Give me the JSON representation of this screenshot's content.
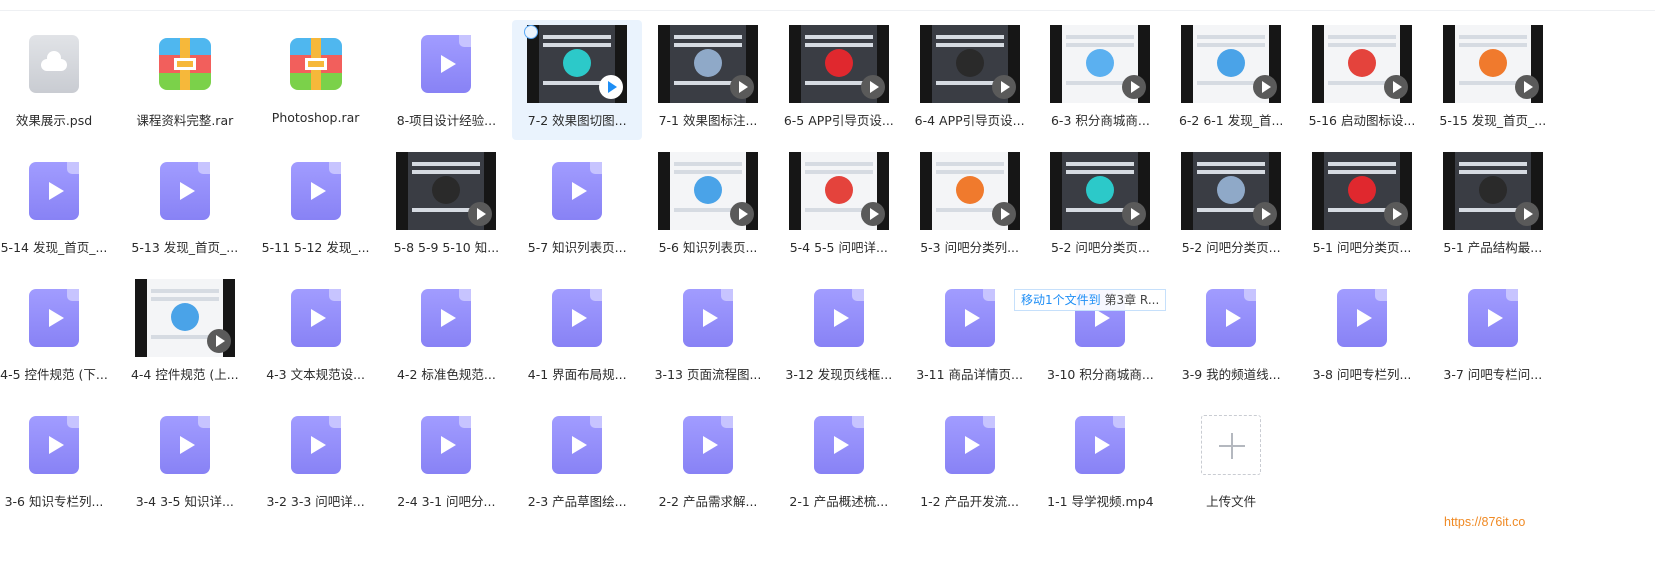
{
  "files": [
    {
      "name": "效果展示.psd",
      "icon": "psd-file-icon",
      "type": "psd"
    },
    {
      "name": "课程资料完整.rar",
      "icon": "rar-archive-icon",
      "type": "rar"
    },
    {
      "name": "Photoshop.rar",
      "icon": "rar-archive-icon",
      "type": "rar"
    },
    {
      "name": "8-项目设计经验...",
      "icon": "video-file-icon",
      "type": "video"
    },
    {
      "name": "7-2 效果图切图...",
      "icon": "video-thumbnail",
      "type": "thumb",
      "selected": true
    },
    {
      "name": "7-1 效果图标注...",
      "icon": "video-thumbnail",
      "type": "thumb"
    },
    {
      "name": "6-5 APP引导页设...",
      "icon": "video-thumbnail",
      "type": "thumb"
    },
    {
      "name": "6-4 APP引导页设...",
      "icon": "video-thumbnail",
      "type": "thumb"
    },
    {
      "name": "6-3 积分商城商...",
      "icon": "video-thumbnail",
      "type": "thumb"
    },
    {
      "name": "6-2 6-1 发现_首...",
      "icon": "video-thumbnail",
      "type": "thumb"
    },
    {
      "name": "5-16 启动图标设...",
      "icon": "video-thumbnail",
      "type": "thumb"
    },
    {
      "name": "5-15 发现_首页_...",
      "icon": "video-thumbnail",
      "type": "thumb"
    },
    {
      "name": "5-14 发现_首页_...",
      "icon": "video-file-icon",
      "type": "video"
    },
    {
      "name": "5-13 发现_首页_...",
      "icon": "video-file-icon",
      "type": "video"
    },
    {
      "name": "5-11 5-12 发现_...",
      "icon": "video-file-icon",
      "type": "video"
    },
    {
      "name": "5-8 5-9 5-10 知...",
      "icon": "video-thumbnail",
      "type": "thumb"
    },
    {
      "name": "5-7 知识列表页...",
      "icon": "video-file-icon",
      "type": "video"
    },
    {
      "name": "5-6 知识列表页...",
      "icon": "video-thumbnail",
      "type": "thumb"
    },
    {
      "name": "5-4 5-5 问吧详...",
      "icon": "video-thumbnail",
      "type": "thumb"
    },
    {
      "name": "5-3 问吧分类列...",
      "icon": "video-thumbnail",
      "type": "thumb"
    },
    {
      "name": "5-2 问吧分类页...",
      "icon": "video-thumbnail",
      "type": "thumb"
    },
    {
      "name": "5-2 问吧分类页...",
      "icon": "video-thumbnail",
      "type": "thumb"
    },
    {
      "name": "5-1 问吧分类页...",
      "icon": "video-thumbnail",
      "type": "thumb"
    },
    {
      "name": "5-1 产品结构最...",
      "icon": "video-thumbnail",
      "type": "thumb"
    },
    {
      "name": "4-5 控件规范 (下...",
      "icon": "video-file-icon",
      "type": "video"
    },
    {
      "name": "4-4 控件规范 (上...",
      "icon": "video-thumbnail",
      "type": "thumb"
    },
    {
      "name": "4-3 文本规范设...",
      "icon": "video-file-icon",
      "type": "video"
    },
    {
      "name": "4-2 标准色规范...",
      "icon": "video-file-icon",
      "type": "video"
    },
    {
      "name": "4-1 界面布局规...",
      "icon": "video-file-icon",
      "type": "video"
    },
    {
      "name": "3-13 页面流程图...",
      "icon": "video-file-icon",
      "type": "video"
    },
    {
      "name": "3-12 发现页线框...",
      "icon": "video-file-icon",
      "type": "video"
    },
    {
      "name": "3-11 商品详情页...",
      "icon": "video-file-icon",
      "type": "video"
    },
    {
      "name": "3-10 积分商城商...",
      "icon": "video-file-icon",
      "type": "video"
    },
    {
      "name": "3-9 我的频道线...",
      "icon": "video-file-icon",
      "type": "video"
    },
    {
      "name": "3-8 问吧专栏列...",
      "icon": "video-file-icon",
      "type": "video"
    },
    {
      "name": "3-7 问吧专栏问...",
      "icon": "video-file-icon",
      "type": "video"
    },
    {
      "name": "3-6 知识专栏列...",
      "icon": "video-file-icon",
      "type": "video"
    },
    {
      "name": "3-4 3-5 知识详...",
      "icon": "video-file-icon",
      "type": "video"
    },
    {
      "name": "3-2 3-3 问吧详...",
      "icon": "video-file-icon",
      "type": "video"
    },
    {
      "name": "2-4 3-1 问吧分...",
      "icon": "video-file-icon",
      "type": "video"
    },
    {
      "name": "2-3 产品草图绘...",
      "icon": "video-file-icon",
      "type": "video"
    },
    {
      "name": "2-2 产品需求解...",
      "icon": "video-file-icon",
      "type": "video"
    },
    {
      "name": "2-1 产品概述梳...",
      "icon": "video-file-icon",
      "type": "video"
    },
    {
      "name": "1-2 产品开发流...",
      "icon": "video-file-icon",
      "type": "video"
    },
    {
      "name": "1-1 导学视频.mp4",
      "icon": "video-file-icon",
      "type": "video"
    },
    {
      "name": "上传文件",
      "icon": "plus-icon",
      "type": "upload"
    }
  ],
  "tooltip": {
    "action": "移动1个文件到",
    "target": "第3章 R..."
  },
  "watermark": "https://876it.co",
  "colors": {
    "accent": "#1e8ef5",
    "video_icon": "#8f89fa",
    "selected_bg": "#eaf3fd"
  }
}
